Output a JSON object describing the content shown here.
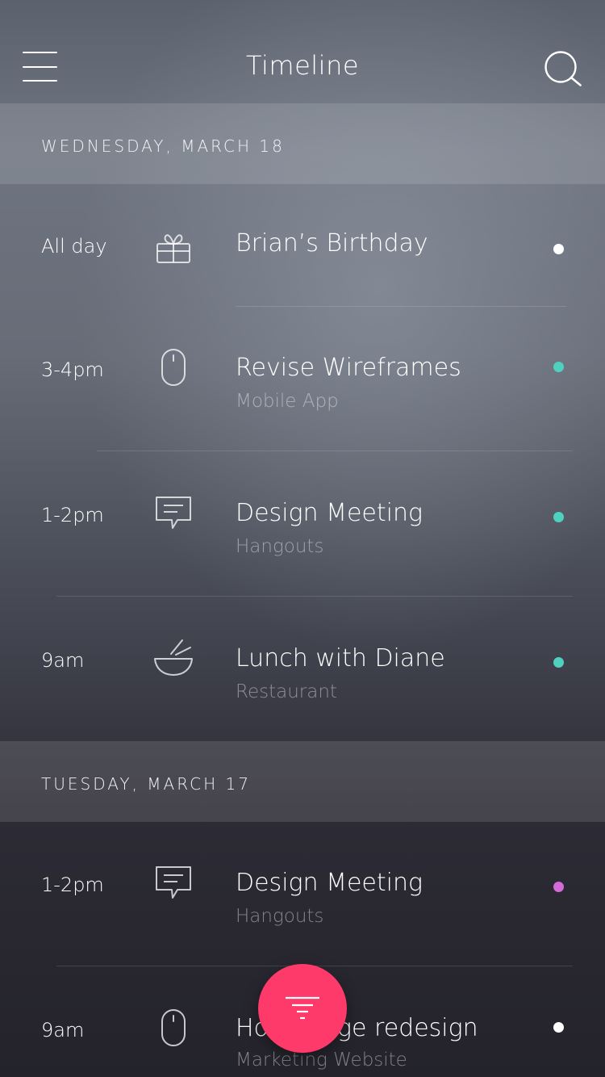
{
  "header": {
    "title": "Timeline",
    "menu_icon": "hamburger-menu-icon",
    "search_icon": "search-icon"
  },
  "sections": [
    {
      "date": "WEDNESDAY, MARCH 18",
      "events": [
        {
          "time": "All day",
          "icon": "gift-icon",
          "title": "Brian’s Birthday",
          "subtitle": "",
          "dot_color": "#ffffff"
        },
        {
          "time": "3-4pm",
          "icon": "mouse-icon",
          "title": "Revise Wireframes",
          "subtitle": "Mobile App",
          "dot_color": "#4fd1c0"
        },
        {
          "time": "1-2pm",
          "icon": "chat-icon",
          "title": "Design Meeting",
          "subtitle": "Hangouts",
          "dot_color": "#4fd1c0"
        },
        {
          "time": "9am",
          "icon": "bowl-chopsticks-icon",
          "title": "Lunch with Diane",
          "subtitle": "Restaurant",
          "dot_color": "#4fd1c0"
        }
      ]
    },
    {
      "date": "TUESDAY, MARCH 17",
      "events": [
        {
          "time": "1-2pm",
          "icon": "chat-icon",
          "title": "Design Meeting",
          "subtitle": "Hangouts",
          "dot_color": "#d46ad7"
        },
        {
          "time": "9am",
          "icon": "mouse-icon",
          "title": "Homepage redesign",
          "subtitle": "Marketing Website",
          "dot_color": "#ffffff"
        }
      ]
    }
  ],
  "fab": {
    "icon": "filter-icon",
    "color": "#fd3a6a"
  }
}
